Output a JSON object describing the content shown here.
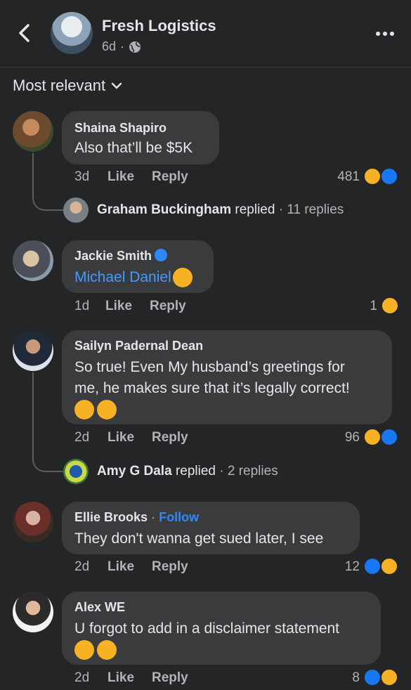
{
  "header": {
    "page_name": "Fresh Logistics",
    "time": "6d",
    "dot": "·",
    "back_icon": "chevron-left-icon",
    "privacy_icon": "globe-icon",
    "more_icon": "more-dots-icon"
  },
  "sort": {
    "label": "Most relevant",
    "icon": "chevron-down-icon"
  },
  "labels": {
    "like": "Like",
    "reply": "Reply",
    "replied": "replied",
    "follow": "Follow"
  },
  "comments": [
    {
      "author": "Shaina Shapiro",
      "text_lines": [
        "Also that’ll be $5K"
      ],
      "time": "3d",
      "reaction_count": "481",
      "reactions": [
        "haha",
        "like"
      ],
      "reply_preview": {
        "name": "Graham Buckingham",
        "suffix": "· 11 replies"
      }
    },
    {
      "author": "Jackie Smith",
      "verified": true,
      "mention": "Michael Daniel",
      "time": "1d",
      "reaction_count": "1",
      "reactions": [
        "haha"
      ]
    },
    {
      "author": "Sailyn Padernal Dean",
      "text_lines": [
        "So true! Even My husband’s greetings for",
        "me, he makes sure that it’s legally correct!"
      ],
      "emojis": [
        "rofl",
        "rofl"
      ],
      "time": "2d",
      "reaction_count": "96",
      "reactions": [
        "haha",
        "like"
      ],
      "reply_preview": {
        "name": "Amy G Dala",
        "suffix": "· 2 replies"
      }
    },
    {
      "author": "Ellie Brooks",
      "follow_sep": "·",
      "text_lines": [
        "They don't wanna get sued later, I see"
      ],
      "time": "2d",
      "reaction_count": "12",
      "reactions": [
        "like",
        "haha"
      ]
    },
    {
      "author": "Alex WE",
      "text_lines": [
        "U forgot to add in a disclaimer statement"
      ],
      "emojis": [
        "sweat-smile",
        "sweat-smile"
      ],
      "time": "2d",
      "reaction_count": "8",
      "reactions": [
        "like",
        "haha"
      ]
    }
  ],
  "colors": {
    "background": "#242526",
    "bubble": "#3a3b3c",
    "link": "#4599ff",
    "like": "#1877f2",
    "haha": "#f7b125"
  }
}
